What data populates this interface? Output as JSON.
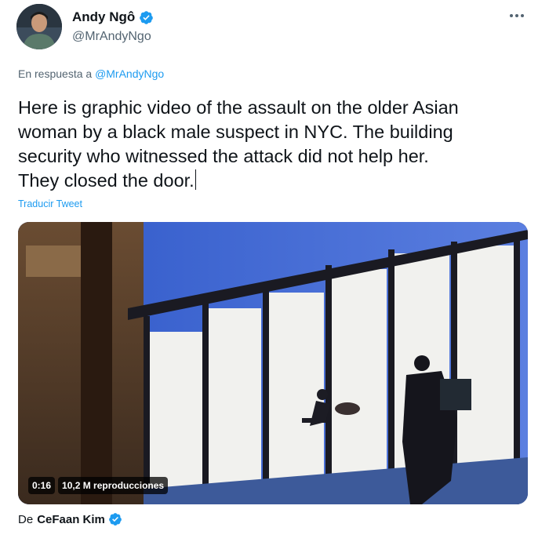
{
  "author": {
    "name": "Andy Ngô",
    "handle": "@MrAndyNgo",
    "verified": true
  },
  "reply": {
    "prefix": "En respuesta a",
    "mention": "@MrAndyNgo"
  },
  "tweet": {
    "text": "Here is graphic video of the assault on the older Asian\nwoman by a black male suspect in NYC. The building\nsecurity who witnessed the attack did not help her.\nThey closed the door.",
    "translate_label": "Traducir Tweet"
  },
  "video": {
    "duration": "0:16",
    "views": "10,2 M reproducciones"
  },
  "source": {
    "prefix": "De",
    "author": "CeFaan Kim",
    "verified": true
  },
  "colors": {
    "accent": "#1d9bf0",
    "text": "#0f1419",
    "muted": "#536471"
  },
  "icons": [
    "verified-badge-icon",
    "more-options-icon"
  ]
}
